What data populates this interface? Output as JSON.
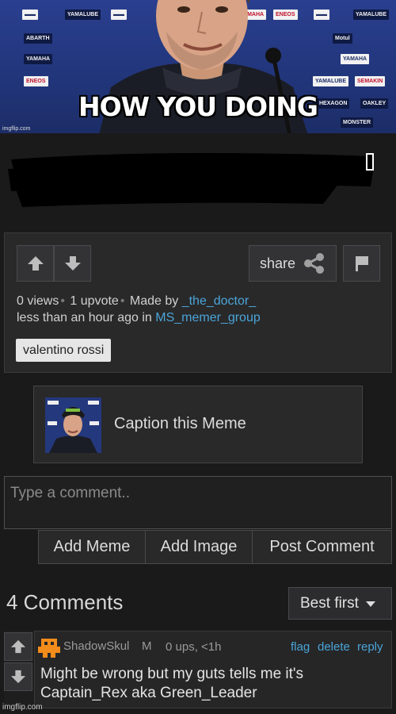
{
  "meme": {
    "caption": "HOW YOU DOING",
    "watermark": "imgflip.com",
    "sponsors": [
      "YAMALUBE",
      "ENEOS",
      "YAMAHA",
      "ABARTH",
      "MONSTER",
      "DESCENT",
      "Cradle",
      "OAKLEY",
      "HEXAGON",
      "SEMAKIN",
      "Motul"
    ]
  },
  "post": {
    "vote_up_icon": "arrow-up-icon",
    "vote_down_icon": "arrow-down-icon",
    "share_label": "share",
    "views": "0 views",
    "upvotes": "1 upvote",
    "made_by_label": "Made by",
    "author": "_the_doctor_",
    "time_label": "less than an hour ago in",
    "stream": "MS_memer_group",
    "tag": "valentino rossi"
  },
  "caption_box": {
    "label": "Caption this Meme"
  },
  "comment_form": {
    "placeholder": "Type a comment..",
    "add_meme": "Add Meme",
    "add_image": "Add Image",
    "post_comment": "Post Comment"
  },
  "comments": {
    "title": "4 Comments",
    "sort_label": "Best first",
    "items": [
      {
        "user": "ShadowSkul",
        "badge": "M",
        "stats": "0 ups, <1h",
        "flag": "flag",
        "delete": "delete",
        "reply": "reply",
        "text": "Might be wrong but my guts tells me it's Captain_Rex aka Green_Leader"
      }
    ]
  },
  "footer_watermark": "imgflip.com",
  "colors": {
    "background": "#1a1a1b",
    "panel": "#29292a",
    "link": "#4aa5d9",
    "avatar": "#f28c1b"
  }
}
